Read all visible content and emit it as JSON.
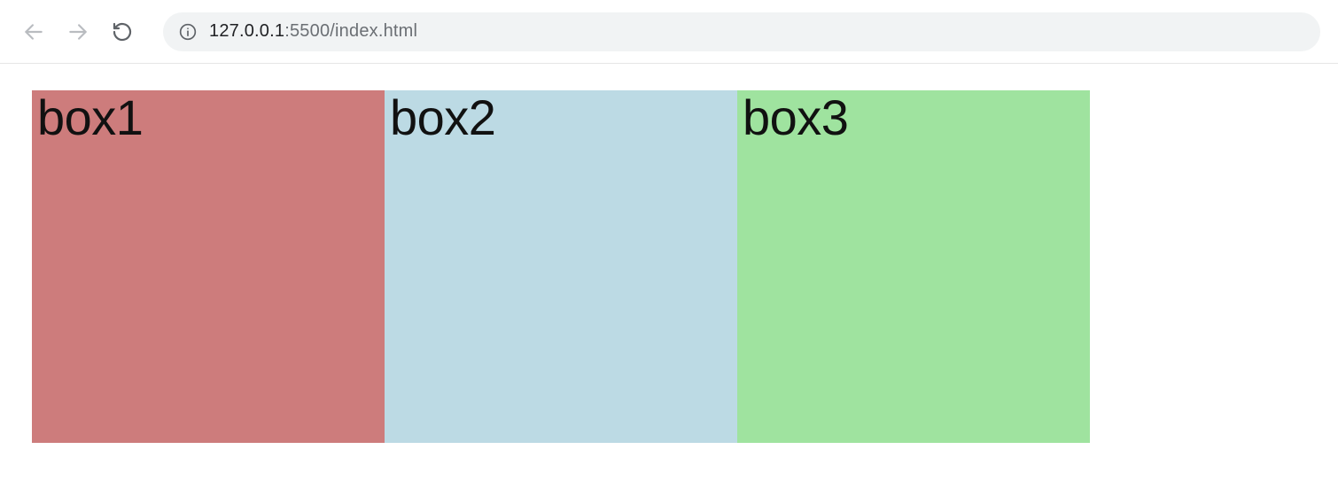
{
  "toolbar": {
    "url_host": "127.0.0.1",
    "url_port_path": ":5500/index.html"
  },
  "page": {
    "boxes": [
      {
        "label": "box1",
        "color": "#cd7c7c"
      },
      {
        "label": "box2",
        "color": "#bcdae4"
      },
      {
        "label": "box3",
        "color": "#9fe39f"
      }
    ]
  }
}
